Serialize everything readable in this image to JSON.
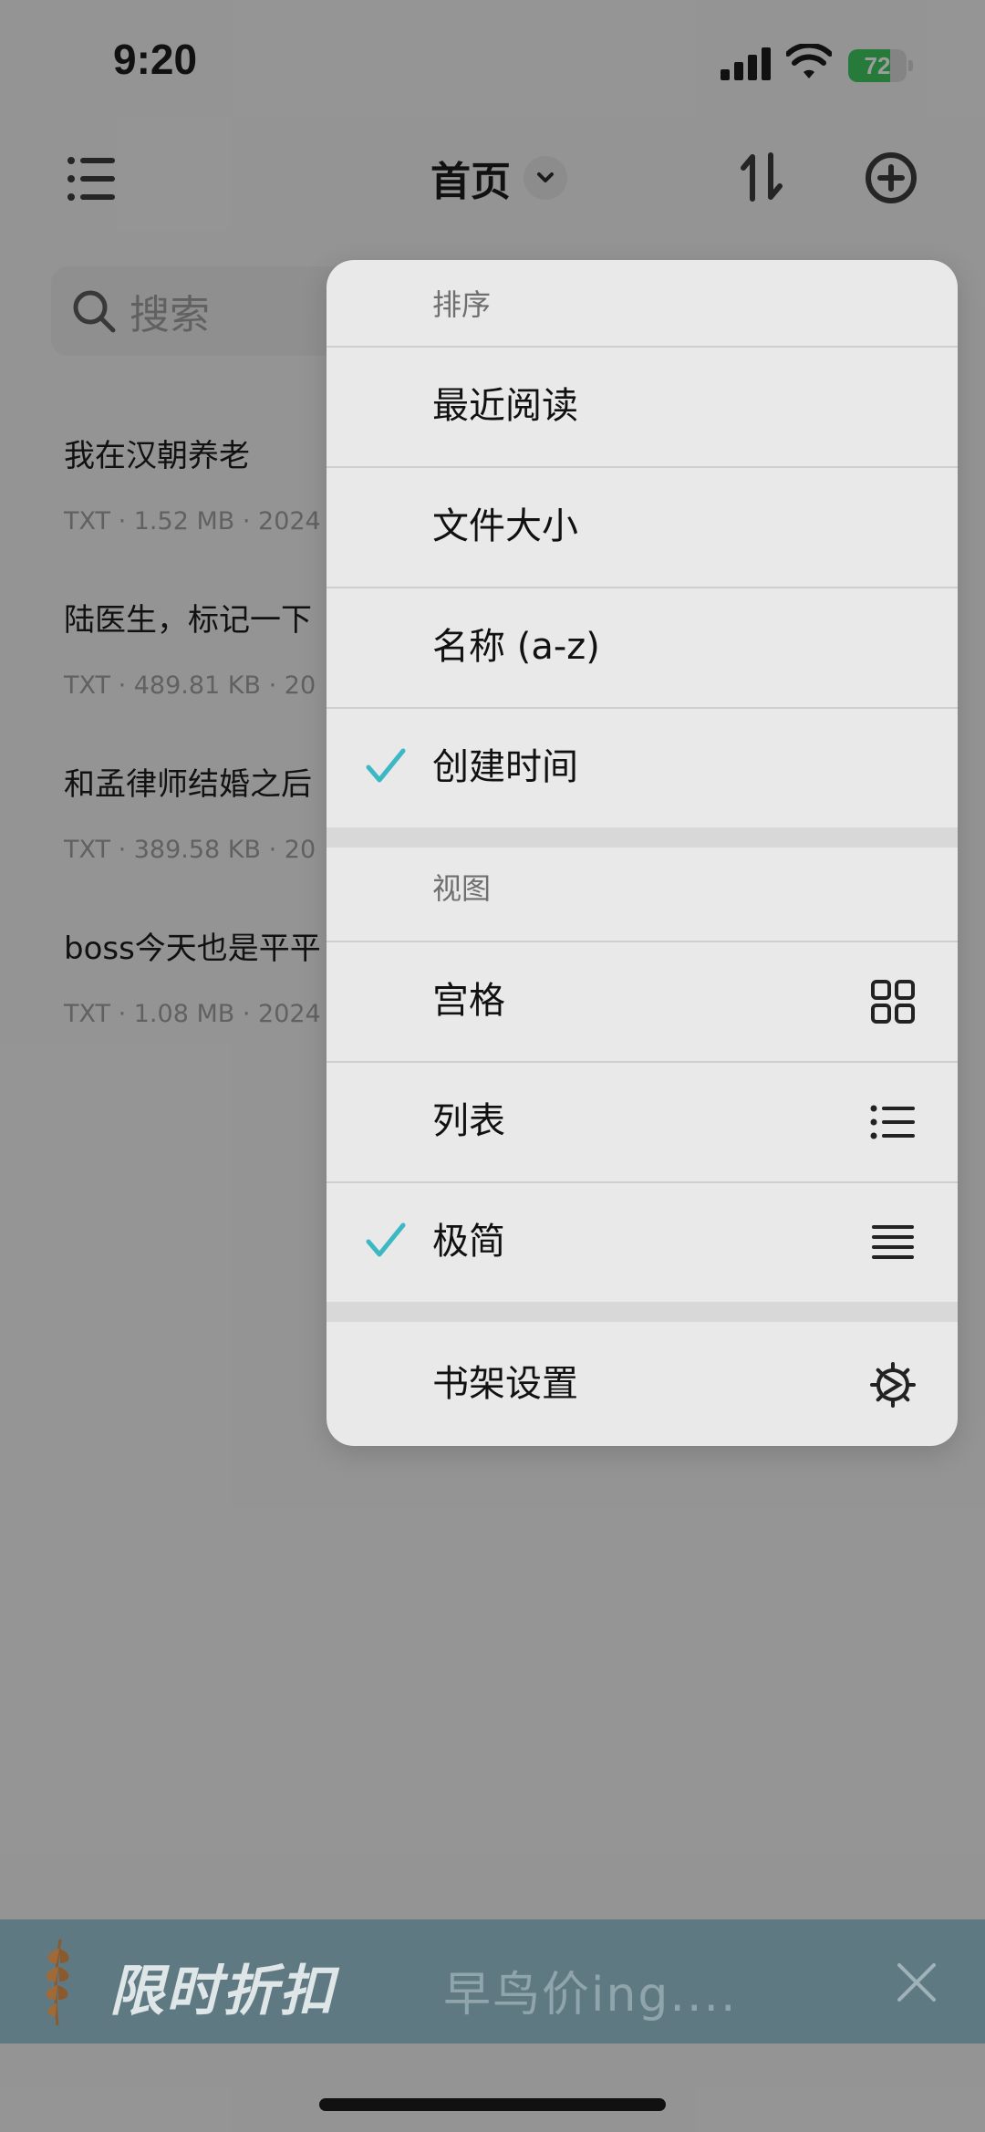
{
  "status_bar": {
    "time": "9:20",
    "battery_level": "72",
    "battery_fraction": 0.72,
    "signal_icon": "cellular-signal-icon",
    "wifi_icon": "wifi-icon"
  },
  "nav": {
    "title": "首页",
    "menu_icon": "list-menu-icon",
    "sort_icon": "sort-icon",
    "add_icon": "add-circle-icon"
  },
  "search": {
    "placeholder": "搜索"
  },
  "books": [
    {
      "title": "我在汉朝养老",
      "meta": "TXT · 1.52 MB · 2024"
    },
    {
      "title": "陆医生，标记一下",
      "meta": "TXT · 489.81 KB · 20"
    },
    {
      "title": "和孟律师结婚之后",
      "meta": "TXT · 389.58 KB · 20"
    },
    {
      "title": "boss今天也是平平",
      "meta": "TXT · 1.08 MB · 2024"
    }
  ],
  "dropdown": {
    "sort_header": "排序",
    "sort_options": [
      {
        "label": "最近阅读",
        "checked": false
      },
      {
        "label": "文件大小",
        "checked": false
      },
      {
        "label": "名称 (a-z)",
        "checked": false
      },
      {
        "label": "创建时间",
        "checked": true
      }
    ],
    "view_header": "视图",
    "view_options": [
      {
        "label": "宫格",
        "checked": false,
        "icon": "grid-icon"
      },
      {
        "label": "列表",
        "checked": false,
        "icon": "list-view-icon"
      },
      {
        "label": "极简",
        "checked": true,
        "icon": "minimal-lines-icon"
      }
    ],
    "settings_label": "书架设置",
    "settings_icon": "gear-icon",
    "check_color": "#3cb8c4"
  },
  "promo": {
    "title": "限时折扣",
    "subtitle": "早鸟价ing....",
    "close_icon": "close-icon",
    "background_color": "#5f7983"
  }
}
